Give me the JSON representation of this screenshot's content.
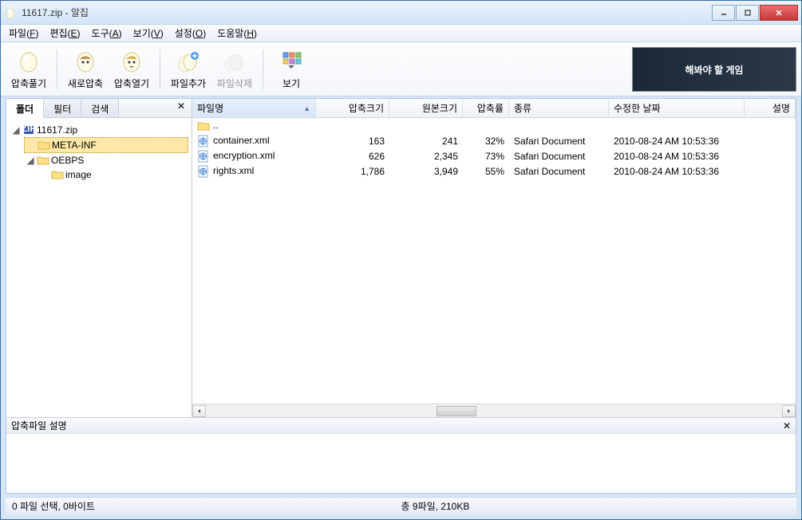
{
  "window": {
    "title": "11617.zip - 알집"
  },
  "menubar": [
    {
      "label": "파일",
      "key": "F"
    },
    {
      "label": "편집",
      "key": "E"
    },
    {
      "label": "도구",
      "key": "A"
    },
    {
      "label": "보기",
      "key": "V"
    },
    {
      "label": "설정",
      "key": "O"
    },
    {
      "label": "도움말",
      "key": "H"
    }
  ],
  "toolbar": {
    "extract": "압축풀기",
    "newarchive": "새로압축",
    "openarchive": "압축열기",
    "addfile": "파일추가",
    "deletefile": "파일삭제",
    "view": "보기"
  },
  "banner": {
    "text": "해봐야 할 게임"
  },
  "left_tabs": {
    "folder": "폴더",
    "filter": "필터",
    "search": "검색"
  },
  "tree": {
    "root": "11617.zip",
    "metainf": "META-INF",
    "oebps": "OEBPS",
    "image": "image"
  },
  "columns": {
    "name": "파일명",
    "csize": "압축크기",
    "osize": "원본크기",
    "ratio": "압축률",
    "type": "종류",
    "date": "수정한 날짜",
    "desc": "설명"
  },
  "files": [
    {
      "name": "..",
      "icon": "folder-up",
      "csize": "",
      "osize": "",
      "ratio": "",
      "type": "",
      "date": ""
    },
    {
      "name": "container.xml",
      "icon": "xml",
      "csize": "163",
      "osize": "241",
      "ratio": "32%",
      "type": "Safari Document",
      "date": "2010-08-24 AM 10:53:36"
    },
    {
      "name": "encryption.xml",
      "icon": "xml",
      "csize": "626",
      "osize": "2,345",
      "ratio": "73%",
      "type": "Safari Document",
      "date": "2010-08-24 AM 10:53:36"
    },
    {
      "name": "rights.xml",
      "icon": "xml",
      "csize": "1,786",
      "osize": "3,949",
      "ratio": "55%",
      "type": "Safari Document",
      "date": "2010-08-24 AM 10:53:36"
    }
  ],
  "desc_panel": {
    "title": "압축파일 설명"
  },
  "statusbar": {
    "left": "0 파일 선택, 0바이트",
    "right": "총 9파일, 210KB"
  }
}
